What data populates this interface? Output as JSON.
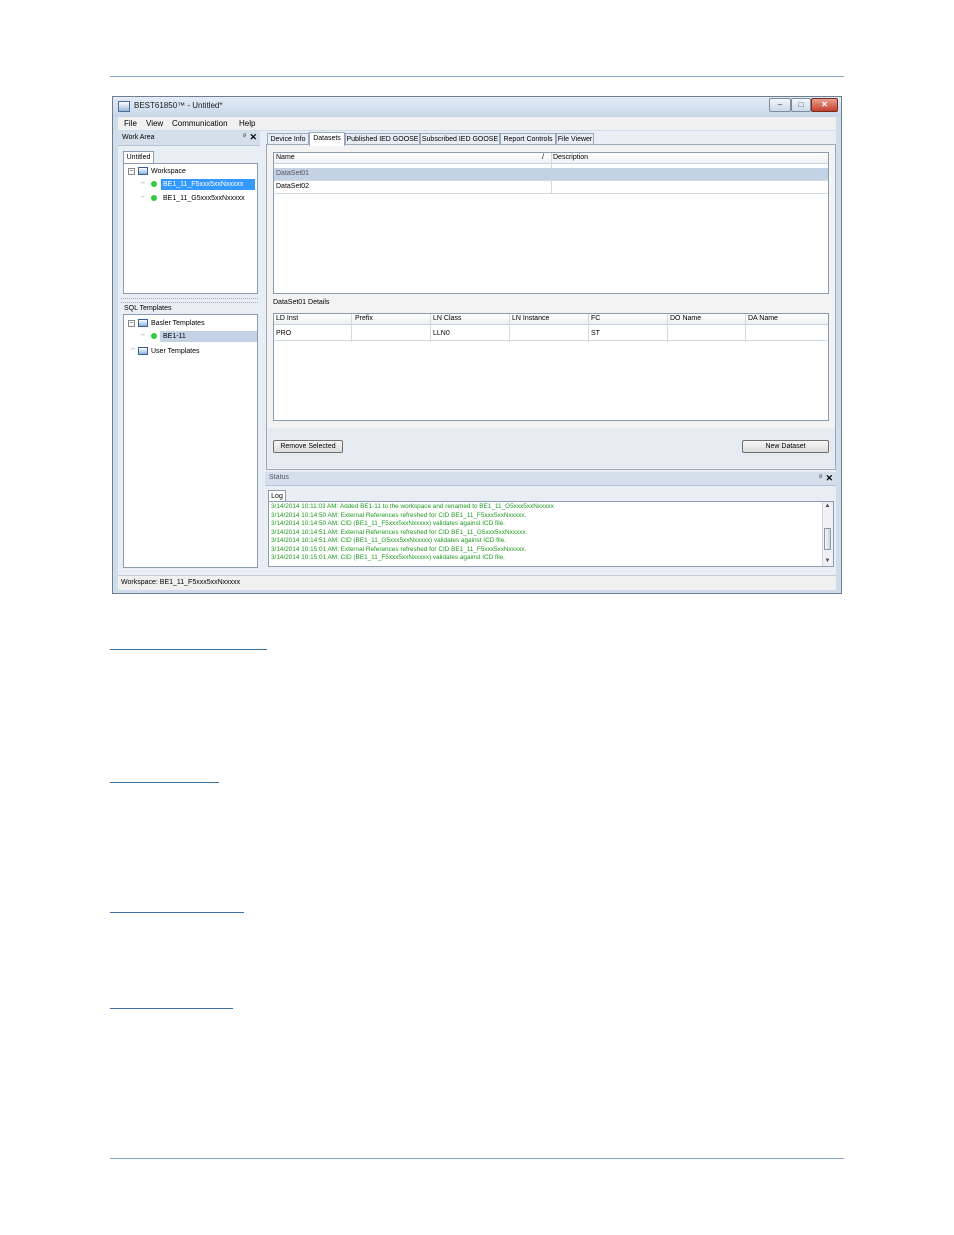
{
  "window": {
    "title": "BEST61850™ - Untitled*",
    "controls": {
      "minimize": "–",
      "maximize": "□",
      "close": "✕"
    }
  },
  "menu": {
    "items": [
      "File",
      "View",
      "Communication",
      "Help"
    ]
  },
  "work_area": {
    "title": "Work Area",
    "pin": "ᵖ",
    "close": "✕",
    "tab": "Untitled",
    "tree": {
      "root": "Workspace",
      "items": [
        "BE1_11_F5xxx5xxNxxxxx",
        "BE1_11_G5xxx5xxNxxxxx"
      ]
    },
    "sql_templates": {
      "title": "SQL Templates",
      "basler": "Basler Templates",
      "basler_items": [
        "BE1-11"
      ],
      "user": "User Templates"
    }
  },
  "tabs": [
    "Device Info",
    "Datasets",
    "Published IED GOOSE",
    "Subscribed IED GOOSE",
    "Report Controls",
    "File Viewer"
  ],
  "datasets": {
    "columns": [
      "Name",
      "Description"
    ],
    "sort_indicator": "/",
    "rows": [
      {
        "name": "DataSet01",
        "description": ""
      },
      {
        "name": "DataSet02",
        "description": ""
      }
    ]
  },
  "details": {
    "label": "DataSet01 Details",
    "columns": [
      "LD Inst",
      "Prefix",
      "LN Class",
      "LN Instance",
      "FC",
      "DO Name",
      "DA Name"
    ],
    "rows": [
      [
        "PRO",
        "",
        "LLN0",
        "",
        "ST",
        "",
        ""
      ]
    ]
  },
  "buttons": {
    "remove": "Remove Selected",
    "new": "New Dataset"
  },
  "status": {
    "title": "Status",
    "pin": "ᵖ",
    "close": "✕",
    "tab": "Log",
    "lines": [
      "3/14/2014 10:11:03 AM: Added BE1-11 to the workspace and renamed to BE1_11_G5xxx5xxNxxxxx",
      "3/14/2014 10:14:50 AM: External References refreshed for CID BE1_11_F5xxx5xxNxxxxx.",
      "3/14/2014 10:14:50 AM: CID (BE1_11_F5xxx5xxNxxxxx) validates against ICD file.",
      "3/14/2014 10:14:51 AM: External References refreshed for CID BE1_11_G5xxx5xxNxxxxx.",
      "3/14/2014 10:14:51 AM: CID (BE1_11_G5xxx5xxNxxxxx) validates against ICD file.",
      "3/14/2014 10:15:01 AM: External References refreshed for CID BE1_11_F5xxx5xxNxxxxx.",
      "3/14/2014 10:15:01 AM: CID (BE1_11_F5xxx5xxNxxxxx) validates against ICD file."
    ]
  },
  "statusbar": {
    "text": "Workspace: BE1_11_F5xxx5xxNxxxxx"
  },
  "colors": {
    "log_text": "#1e9a1e",
    "selection": "#3399ff",
    "status_dot": "#2ecc40",
    "rule": "#7fa7c9"
  }
}
